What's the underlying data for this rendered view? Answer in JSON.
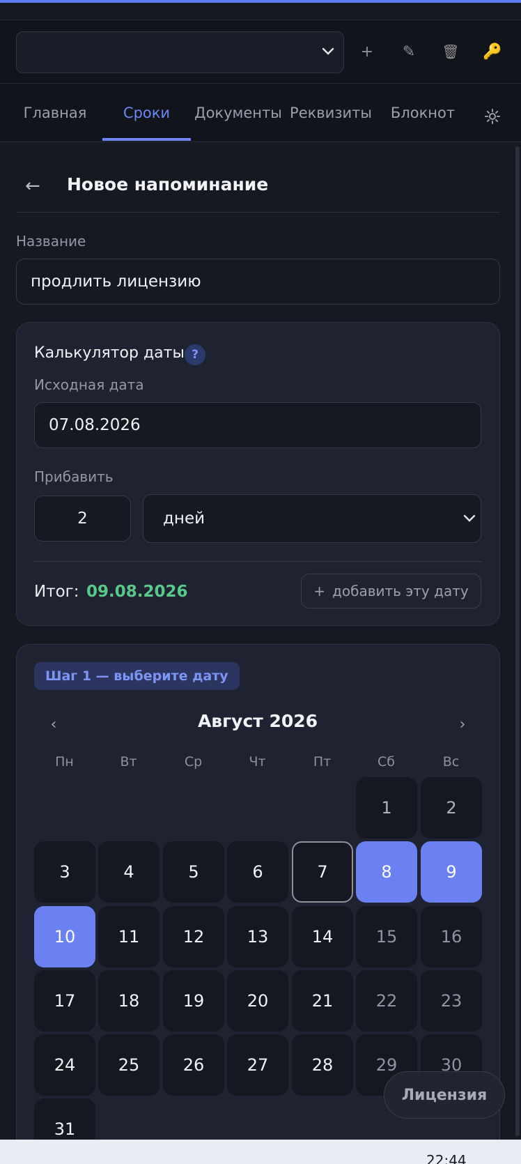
{
  "toolbar": {
    "profile_value": "",
    "icons": [
      "plus-icon",
      "pencil-icon",
      "trash-icon",
      "key-icon"
    ],
    "plus_glyph": "+",
    "pencil_glyph": "✎",
    "trash_glyph": "🗑",
    "key_glyph": "🔑"
  },
  "tabs": [
    {
      "label": "Главная",
      "active": false
    },
    {
      "label": "Сроки",
      "active": true
    },
    {
      "label": "Документы",
      "active": false
    },
    {
      "label": "Реквизиты",
      "active": false
    },
    {
      "label": "Блокнот",
      "active": false
    }
  ],
  "header": {
    "back_glyph": "←",
    "title": "Новое напоминание"
  },
  "form": {
    "name_label": "Название",
    "name_value": "продлить лицензию"
  },
  "calculator": {
    "title": "Калькулятор даты",
    "help_glyph": "?",
    "source_label": "Исходная дата",
    "source_value": "07.08.2026",
    "add_label": "Прибавить",
    "amount_value": "2",
    "unit_value": "дней",
    "result_label": "Итог:",
    "result_value": "09.08.2026",
    "add_button_plus": "+",
    "add_button_label": "добавить эту дату"
  },
  "calendar": {
    "step_badge": "Шаг 1 — выберите дату",
    "prev_glyph": "‹",
    "next_glyph": "›",
    "month_title": "Август 2026",
    "weekdays": [
      "Пн",
      "Вт",
      "Ср",
      "Чт",
      "Пт",
      "Сб",
      "Вс"
    ],
    "days": [
      "1",
      "2",
      "3",
      "4",
      "5",
      "6",
      "7",
      "8",
      "9",
      "10",
      "11",
      "12",
      "13",
      "14",
      "15",
      "16",
      "17",
      "18",
      "19",
      "20",
      "21",
      "22",
      "23",
      "24",
      "25",
      "26",
      "27",
      "28",
      "29",
      "30",
      "31"
    ],
    "today": "7",
    "selected": [
      "8",
      "9",
      "10"
    ]
  },
  "license_button": "Лицензия",
  "taskbar": {
    "clock": "22:44"
  },
  "colors": {
    "accent": "#6b80f1",
    "result": "#59c98a",
    "background": "#161922"
  }
}
